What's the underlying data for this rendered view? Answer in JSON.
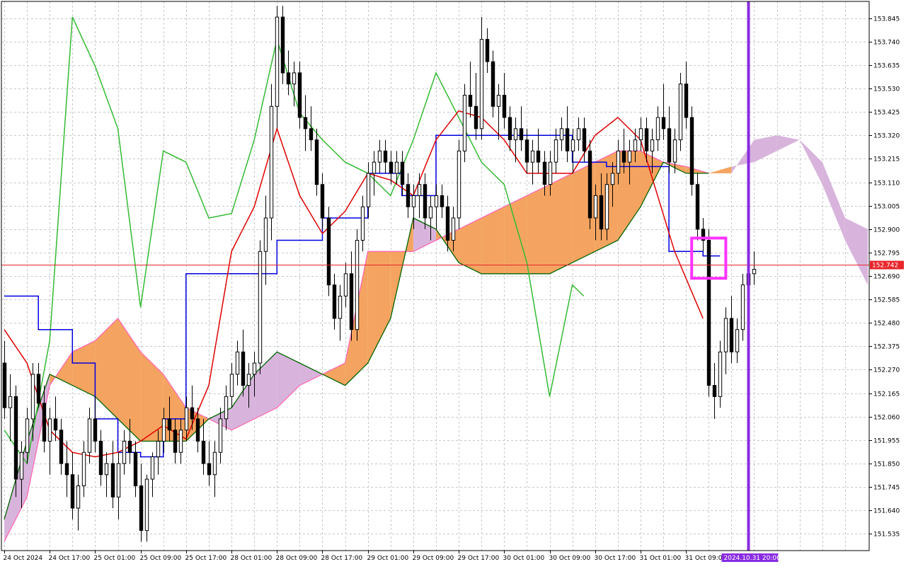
{
  "chart_data": {
    "type": "candlestick",
    "instrument": "",
    "y_axis": {
      "ticks": [
        153.845,
        153.74,
        153.635,
        153.53,
        153.425,
        153.32,
        153.215,
        153.11,
        153.005,
        152.9,
        152.795,
        152.69,
        152.585,
        152.48,
        152.375,
        152.27,
        152.165,
        152.06,
        151.955,
        151.85,
        151.745,
        151.64,
        151.535
      ],
      "tick_labels": [
        "153.845",
        "153.740",
        "153.635",
        "153.530",
        "153.425",
        "153.320",
        "153.215",
        "153.110",
        "153.005",
        "152.900",
        "152.795",
        "152.690",
        "152.585",
        "152.480",
        "152.375",
        "152.270",
        "152.165",
        "152.060",
        "151.955",
        "151.850",
        "151.745",
        "151.640",
        "151.535"
      ],
      "range": [
        151.46,
        153.92
      ]
    },
    "x_axis": {
      "tick_labels": [
        "24 Oct 2024",
        "24 Oct 17:00",
        "25 Oct 01:00",
        "25 Oct 09:00",
        "25 Oct 17:00",
        "28 Oct 01:00",
        "28 Oct 09:00",
        "28 Oct 17:00",
        "29 Oct 01:00",
        "29 Oct 09:00",
        "29 Oct 17:00",
        "30 Oct 01:00",
        "30 Oct 09:00",
        "30 Oct 17:00",
        "31 Oct 01:00",
        "31 Oct 09:00"
      ],
      "tick_bar_index": [
        0,
        16,
        32,
        48,
        64,
        80,
        96,
        112,
        128,
        144,
        160,
        176,
        192,
        208,
        224,
        240
      ],
      "total_bars_including_future": 304
    },
    "current_price": {
      "value": 152.742,
      "label": "152.742",
      "color": "#e8262b"
    },
    "vertical_marker": {
      "label": "2024.10.31 20:00",
      "bar_index": 262,
      "color": "#8a2be2"
    },
    "highlight_box": {
      "bar_start": 242,
      "bar_end": 254,
      "price_top": 152.86,
      "price_bottom": 152.68,
      "color": "#ff33ff"
    },
    "colors": {
      "grid": "#c8c8c8",
      "bull_body": "#ffffff",
      "bear_body": "#000000",
      "bull_body_bold": "#2a5ea8",
      "tenkan": "#e00000",
      "kijun": "#0000e0",
      "chikou": "#33bb33",
      "cloud_bull": "#f4a460",
      "cloud_bear": "#d8b4dc",
      "senkou_a_line": "#ff69b4",
      "senkou_b_line": "#006400"
    },
    "candles": [
      [
        152.3,
        152.4,
        152.05,
        152.1
      ],
      [
        152.1,
        152.25,
        151.95,
        152.15
      ],
      [
        152.15,
        152.2,
        151.7,
        151.78
      ],
      [
        151.78,
        151.95,
        151.65,
        151.9
      ],
      [
        151.9,
        152.1,
        151.85,
        152.05
      ],
      [
        152.05,
        152.3,
        151.95,
        152.25
      ],
      [
        152.25,
        152.3,
        152.1,
        152.12
      ],
      [
        152.12,
        152.2,
        151.9,
        151.95
      ],
      [
        151.95,
        152.1,
        151.8,
        152.05
      ],
      [
        152.05,
        152.15,
        151.95,
        152.0
      ],
      [
        152.0,
        152.05,
        151.8,
        151.85
      ],
      [
        151.85,
        151.95,
        151.7,
        151.8
      ],
      [
        151.8,
        151.9,
        151.6,
        151.65
      ],
      [
        151.65,
        151.8,
        151.55,
        151.75
      ],
      [
        151.75,
        151.95,
        151.7,
        151.9
      ],
      [
        151.9,
        152.1,
        151.85,
        152.05
      ],
      [
        152.05,
        152.15,
        151.9,
        151.95
      ],
      [
        151.95,
        152.0,
        151.75,
        151.8
      ],
      [
        151.8,
        151.9,
        151.7,
        151.85
      ],
      [
        151.85,
        151.95,
        151.65,
        151.7
      ],
      [
        151.7,
        151.9,
        151.6,
        151.85
      ],
      [
        151.85,
        152.0,
        151.8,
        151.95
      ],
      [
        151.95,
        152.05,
        151.85,
        151.9
      ],
      [
        151.9,
        151.95,
        151.7,
        151.75
      ],
      [
        151.75,
        151.85,
        151.5,
        151.55
      ],
      [
        151.55,
        151.8,
        151.5,
        151.78
      ],
      [
        151.78,
        151.9,
        151.7,
        151.88
      ],
      [
        151.88,
        152.0,
        151.8,
        151.95
      ],
      [
        151.95,
        152.1,
        151.9,
        152.05
      ],
      [
        152.05,
        152.15,
        151.95,
        152.0
      ],
      [
        152.0,
        152.05,
        151.85,
        151.9
      ],
      [
        151.9,
        152.05,
        151.85,
        152.0
      ],
      [
        152.0,
        152.15,
        151.95,
        152.1
      ],
      [
        152.1,
        152.2,
        152.0,
        152.05
      ],
      [
        152.05,
        152.1,
        151.9,
        151.95
      ],
      [
        151.95,
        152.05,
        151.8,
        151.85
      ],
      [
        151.85,
        151.95,
        151.75,
        151.8
      ],
      [
        151.8,
        151.95,
        151.7,
        151.9
      ],
      [
        151.9,
        152.1,
        151.85,
        152.05
      ],
      [
        152.05,
        152.2,
        152.0,
        152.15
      ],
      [
        152.15,
        152.3,
        152.1,
        152.25
      ],
      [
        152.25,
        152.4,
        152.2,
        152.35
      ],
      [
        152.35,
        152.45,
        152.15,
        152.2
      ],
      [
        152.2,
        152.3,
        152.1,
        152.25
      ],
      [
        152.25,
        152.35,
        152.15,
        152.3
      ],
      [
        152.3,
        152.85,
        152.25,
        152.8
      ],
      [
        152.8,
        153.05,
        152.65,
        152.95
      ],
      [
        152.95,
        153.55,
        152.85,
        153.45
      ],
      [
        153.45,
        153.9,
        153.35,
        153.85
      ],
      [
        153.85,
        153.9,
        153.55,
        153.6
      ],
      [
        153.6,
        153.7,
        153.5,
        153.55
      ],
      [
        153.55,
        153.65,
        153.45,
        153.6
      ],
      [
        153.6,
        153.65,
        153.35,
        153.4
      ],
      [
        153.4,
        153.5,
        153.25,
        153.35
      ],
      [
        153.35,
        153.45,
        153.25,
        153.3
      ],
      [
        153.3,
        153.35,
        153.05,
        153.1
      ],
      [
        153.1,
        153.15,
        152.9,
        152.95
      ],
      [
        152.95,
        153.0,
        152.6,
        152.65
      ],
      [
        152.65,
        152.7,
        152.45,
        152.5
      ],
      [
        152.5,
        152.65,
        152.4,
        152.6
      ],
      [
        152.6,
        152.75,
        152.55,
        152.7
      ],
      [
        152.7,
        152.8,
        152.4,
        152.45
      ],
      [
        152.45,
        152.9,
        152.4,
        152.85
      ],
      [
        152.85,
        153.05,
        152.8,
        153.0
      ],
      [
        153.0,
        153.2,
        152.95,
        153.15
      ],
      [
        153.15,
        153.25,
        153.05,
        153.2
      ],
      [
        153.2,
        153.3,
        153.15,
        153.25
      ],
      [
        153.25,
        153.3,
        153.15,
        153.2
      ],
      [
        153.2,
        153.25,
        153.1,
        153.15
      ],
      [
        153.15,
        153.25,
        153.1,
        153.2
      ],
      [
        153.2,
        153.25,
        153.05,
        153.1
      ],
      [
        153.1,
        153.15,
        152.95,
        153.0
      ],
      [
        153.0,
        153.1,
        152.9,
        153.05
      ],
      [
        153.05,
        153.15,
        152.95,
        153.1
      ],
      [
        153.1,
        153.15,
        152.9,
        152.95
      ],
      [
        152.95,
        153.05,
        152.85,
        153.0
      ],
      [
        153.0,
        153.1,
        152.9,
        153.05
      ],
      [
        153.05,
        153.1,
        152.95,
        153.0
      ],
      [
        153.0,
        153.05,
        152.8,
        152.85
      ],
      [
        152.85,
        153.0,
        152.8,
        152.95
      ],
      [
        152.95,
        153.3,
        152.9,
        153.25
      ],
      [
        153.25,
        153.55,
        153.2,
        153.5
      ],
      [
        153.5,
        153.65,
        153.4,
        153.45
      ],
      [
        153.45,
        153.6,
        153.3,
        153.35
      ],
      [
        153.35,
        153.85,
        153.3,
        153.75
      ],
      [
        153.75,
        153.8,
        153.6,
        153.65
      ],
      [
        153.65,
        153.7,
        153.4,
        153.45
      ],
      [
        153.45,
        153.55,
        153.3,
        153.5
      ],
      [
        153.5,
        153.6,
        153.35,
        153.4
      ],
      [
        153.4,
        153.45,
        153.25,
        153.3
      ],
      [
        153.3,
        153.4,
        153.2,
        153.35
      ],
      [
        153.35,
        153.45,
        153.25,
        153.3
      ],
      [
        153.3,
        153.35,
        153.15,
        153.2
      ],
      [
        153.2,
        153.3,
        153.1,
        153.25
      ],
      [
        153.25,
        153.35,
        153.15,
        153.2
      ],
      [
        153.2,
        153.25,
        153.05,
        153.1
      ],
      [
        153.1,
        153.25,
        153.05,
        153.2
      ],
      [
        153.2,
        153.35,
        153.15,
        153.3
      ],
      [
        153.3,
        153.4,
        153.25,
        153.35
      ],
      [
        153.35,
        153.45,
        153.2,
        153.25
      ],
      [
        153.25,
        153.35,
        153.15,
        153.3
      ],
      [
        153.3,
        153.4,
        153.25,
        153.35
      ],
      [
        153.35,
        153.4,
        153.2,
        153.25
      ],
      [
        153.25,
        153.3,
        152.9,
        152.95
      ],
      [
        152.95,
        153.1,
        152.85,
        153.05
      ],
      [
        153.05,
        153.15,
        152.85,
        152.9
      ],
      [
        152.9,
        153.15,
        152.85,
        153.1
      ],
      [
        153.1,
        153.2,
        153.0,
        153.15
      ],
      [
        153.15,
        153.3,
        153.1,
        153.25
      ],
      [
        153.25,
        153.35,
        153.15,
        153.2
      ],
      [
        153.2,
        153.3,
        153.1,
        153.25
      ],
      [
        153.25,
        153.35,
        153.2,
        153.3
      ],
      [
        153.3,
        153.4,
        153.25,
        153.35
      ],
      [
        153.35,
        153.4,
        153.2,
        153.25
      ],
      [
        153.25,
        153.35,
        153.15,
        153.3
      ],
      [
        153.3,
        153.45,
        153.25,
        153.4
      ],
      [
        153.4,
        153.55,
        153.3,
        153.35
      ],
      [
        153.35,
        153.45,
        153.15,
        153.2
      ],
      [
        153.2,
        153.35,
        153.15,
        153.3
      ],
      [
        153.3,
        153.6,
        153.25,
        153.55
      ],
      [
        153.55,
        153.65,
        153.35,
        153.4
      ],
      [
        153.4,
        153.45,
        153.05,
        153.1
      ],
      [
        153.1,
        153.15,
        152.85,
        152.9
      ],
      [
        152.9,
        152.95,
        152.8,
        152.85
      ],
      [
        152.85,
        152.9,
        152.15,
        152.2
      ],
      [
        152.2,
        152.3,
        152.05,
        152.15
      ],
      [
        152.15,
        152.4,
        152.1,
        152.35
      ],
      [
        152.35,
        152.55,
        152.25,
        152.5
      ],
      [
        152.5,
        152.6,
        152.3,
        152.35
      ],
      [
        152.35,
        152.5,
        152.3,
        152.45
      ],
      [
        152.45,
        152.7,
        152.4,
        152.65
      ],
      [
        152.65,
        152.95,
        152.6,
        152.7
      ],
      [
        152.7,
        152.8,
        152.65,
        152.72
      ]
    ],
    "candle_bar_index_start": 0,
    "candle_bar_index_step": 2,
    "tenkan": [
      [
        0,
        152.45
      ],
      [
        8,
        152.3
      ],
      [
        16,
        152.0
      ],
      [
        24,
        151.9
      ],
      [
        32,
        151.88
      ],
      [
        40,
        151.9
      ],
      [
        48,
        151.95
      ],
      [
        56,
        152.02
      ],
      [
        64,
        151.96
      ],
      [
        72,
        152.2
      ],
      [
        80,
        152.8
      ],
      [
        88,
        153.0
      ],
      [
        96,
        153.35
      ],
      [
        104,
        153.05
      ],
      [
        112,
        152.88
      ],
      [
        120,
        152.98
      ],
      [
        128,
        153.15
      ],
      [
        136,
        153.12
      ],
      [
        144,
        153.05
      ],
      [
        152,
        153.3
      ],
      [
        160,
        153.43
      ],
      [
        168,
        153.4
      ],
      [
        176,
        153.3
      ],
      [
        184,
        153.15
      ],
      [
        192,
        153.15
      ],
      [
        200,
        153.15
      ],
      [
        208,
        153.32
      ],
      [
        216,
        153.4
      ],
      [
        224,
        153.3
      ],
      [
        236,
        152.8
      ],
      [
        246,
        152.5
      ]
    ],
    "kijun": [
      [
        0,
        152.6
      ],
      [
        12,
        152.45
      ],
      [
        24,
        152.3
      ],
      [
        32,
        152.05
      ],
      [
        40,
        151.9
      ],
      [
        48,
        151.88
      ],
      [
        56,
        152.05
      ],
      [
        64,
        152.7
      ],
      [
        80,
        152.7
      ],
      [
        96,
        152.85
      ],
      [
        112,
        152.95
      ],
      [
        128,
        153.15
      ],
      [
        140,
        153.05
      ],
      [
        152,
        153.32
      ],
      [
        168,
        153.32
      ],
      [
        184,
        153.32
      ],
      [
        200,
        153.2
      ],
      [
        212,
        153.18
      ],
      [
        224,
        153.18
      ],
      [
        234,
        152.8
      ],
      [
        246,
        152.78
      ],
      [
        252,
        152.78
      ]
    ],
    "chikou": [
      [
        0,
        152.0
      ],
      [
        8,
        151.85
      ],
      [
        16,
        152.4
      ],
      [
        24,
        153.85
      ],
      [
        32,
        153.63
      ],
      [
        40,
        153.35
      ],
      [
        48,
        152.55
      ],
      [
        56,
        153.25
      ],
      [
        64,
        153.2
      ],
      [
        72,
        152.95
      ],
      [
        80,
        152.97
      ],
      [
        88,
        153.3
      ],
      [
        96,
        153.75
      ],
      [
        104,
        153.42
      ],
      [
        112,
        153.3
      ],
      [
        120,
        153.2
      ],
      [
        128,
        153.15
      ],
      [
        136,
        153.05
      ],
      [
        144,
        153.3
      ],
      [
        152,
        153.6
      ],
      [
        160,
        153.4
      ],
      [
        168,
        153.2
      ],
      [
        176,
        153.1
      ],
      [
        184,
        152.75
      ],
      [
        192,
        152.15
      ],
      [
        200,
        152.65
      ],
      [
        204,
        152.6
      ]
    ],
    "cloud": [
      [
        0,
        151.5,
        151.6
      ],
      [
        8,
        151.7,
        151.95
      ],
      [
        16,
        152.2,
        152.25
      ],
      [
        24,
        152.35,
        152.2
      ],
      [
        32,
        152.4,
        152.15
      ],
      [
        40,
        152.5,
        152.05
      ],
      [
        48,
        152.35,
        151.95
      ],
      [
        56,
        152.25,
        151.95
      ],
      [
        64,
        152.1,
        151.95
      ],
      [
        72,
        152.05,
        152.05
      ],
      [
        80,
        152.0,
        152.1
      ],
      [
        88,
        152.05,
        152.25
      ],
      [
        96,
        152.1,
        152.35
      ],
      [
        104,
        152.2,
        152.3
      ],
      [
        112,
        152.25,
        152.25
      ],
      [
        120,
        152.3,
        152.2
      ],
      [
        128,
        152.8,
        152.3
      ],
      [
        136,
        152.8,
        152.5
      ],
      [
        144,
        152.8,
        152.95
      ],
      [
        152,
        152.85,
        152.9
      ],
      [
        160,
        152.9,
        152.75
      ],
      [
        168,
        152.95,
        152.7
      ],
      [
        176,
        153.0,
        152.7
      ],
      [
        184,
        153.05,
        152.7
      ],
      [
        192,
        153.1,
        152.7
      ],
      [
        200,
        153.15,
        152.75
      ],
      [
        208,
        153.2,
        152.8
      ],
      [
        216,
        153.25,
        152.85
      ],
      [
        224,
        153.25,
        153.0
      ],
      [
        232,
        153.2,
        153.2
      ],
      [
        240,
        153.18,
        153.15
      ],
      [
        248,
        153.15,
        153.15
      ],
      [
        256,
        153.18,
        153.15
      ],
      [
        264,
        153.2,
        153.3
      ],
      [
        272,
        153.25,
        153.32
      ],
      [
        280,
        153.3,
        153.3
      ],
      [
        288,
        153.1,
        153.2
      ],
      [
        296,
        152.85,
        152.95
      ],
      [
        304,
        152.65,
        152.9
      ]
    ]
  }
}
